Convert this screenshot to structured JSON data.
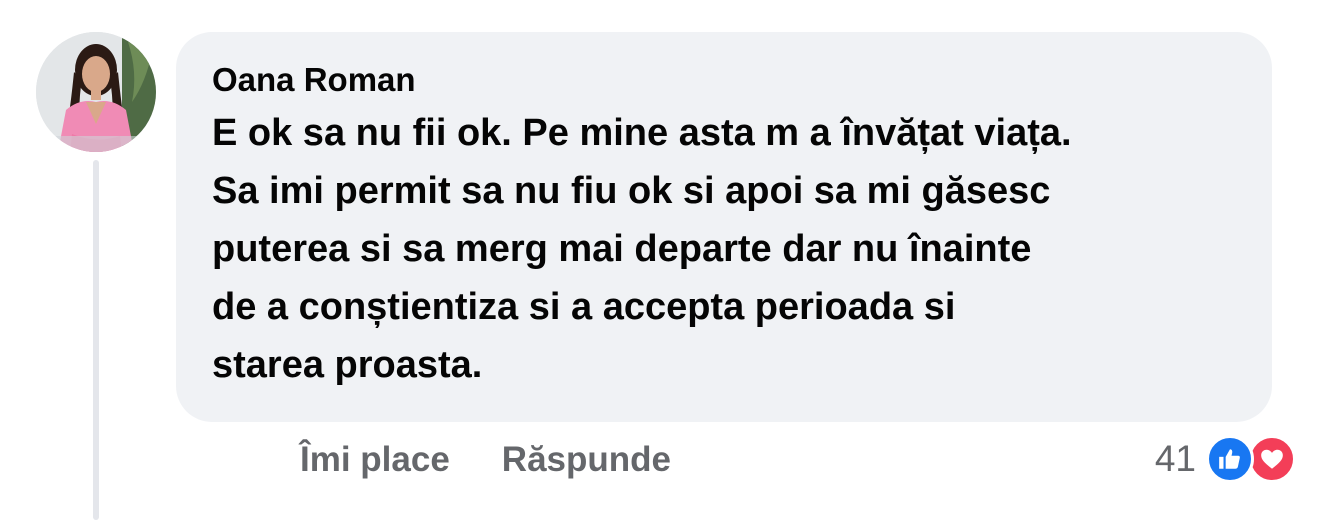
{
  "comment": {
    "author": "Oana Roman",
    "lines": [
      "E ok sa nu fii ok. Pe mine asta m a învățat viața.",
      "Sa imi permit sa nu fiu ok si apoi sa mi găsesc",
      "puterea si sa merg mai departe dar nu înainte",
      "de a conștientiza si a accepta perioada si",
      "starea proasta."
    ]
  },
  "actions": {
    "like_label": "Îmi place",
    "reply_label": "Răspunde"
  },
  "reactions": {
    "count": "41",
    "icons": [
      "like-icon",
      "love-icon"
    ],
    "colors": {
      "like": "#1877f2",
      "love": "#f33e58"
    }
  },
  "colors": {
    "bubble_bg": "#f0f2f5",
    "text": "#050505",
    "secondary_text": "#65676b"
  }
}
